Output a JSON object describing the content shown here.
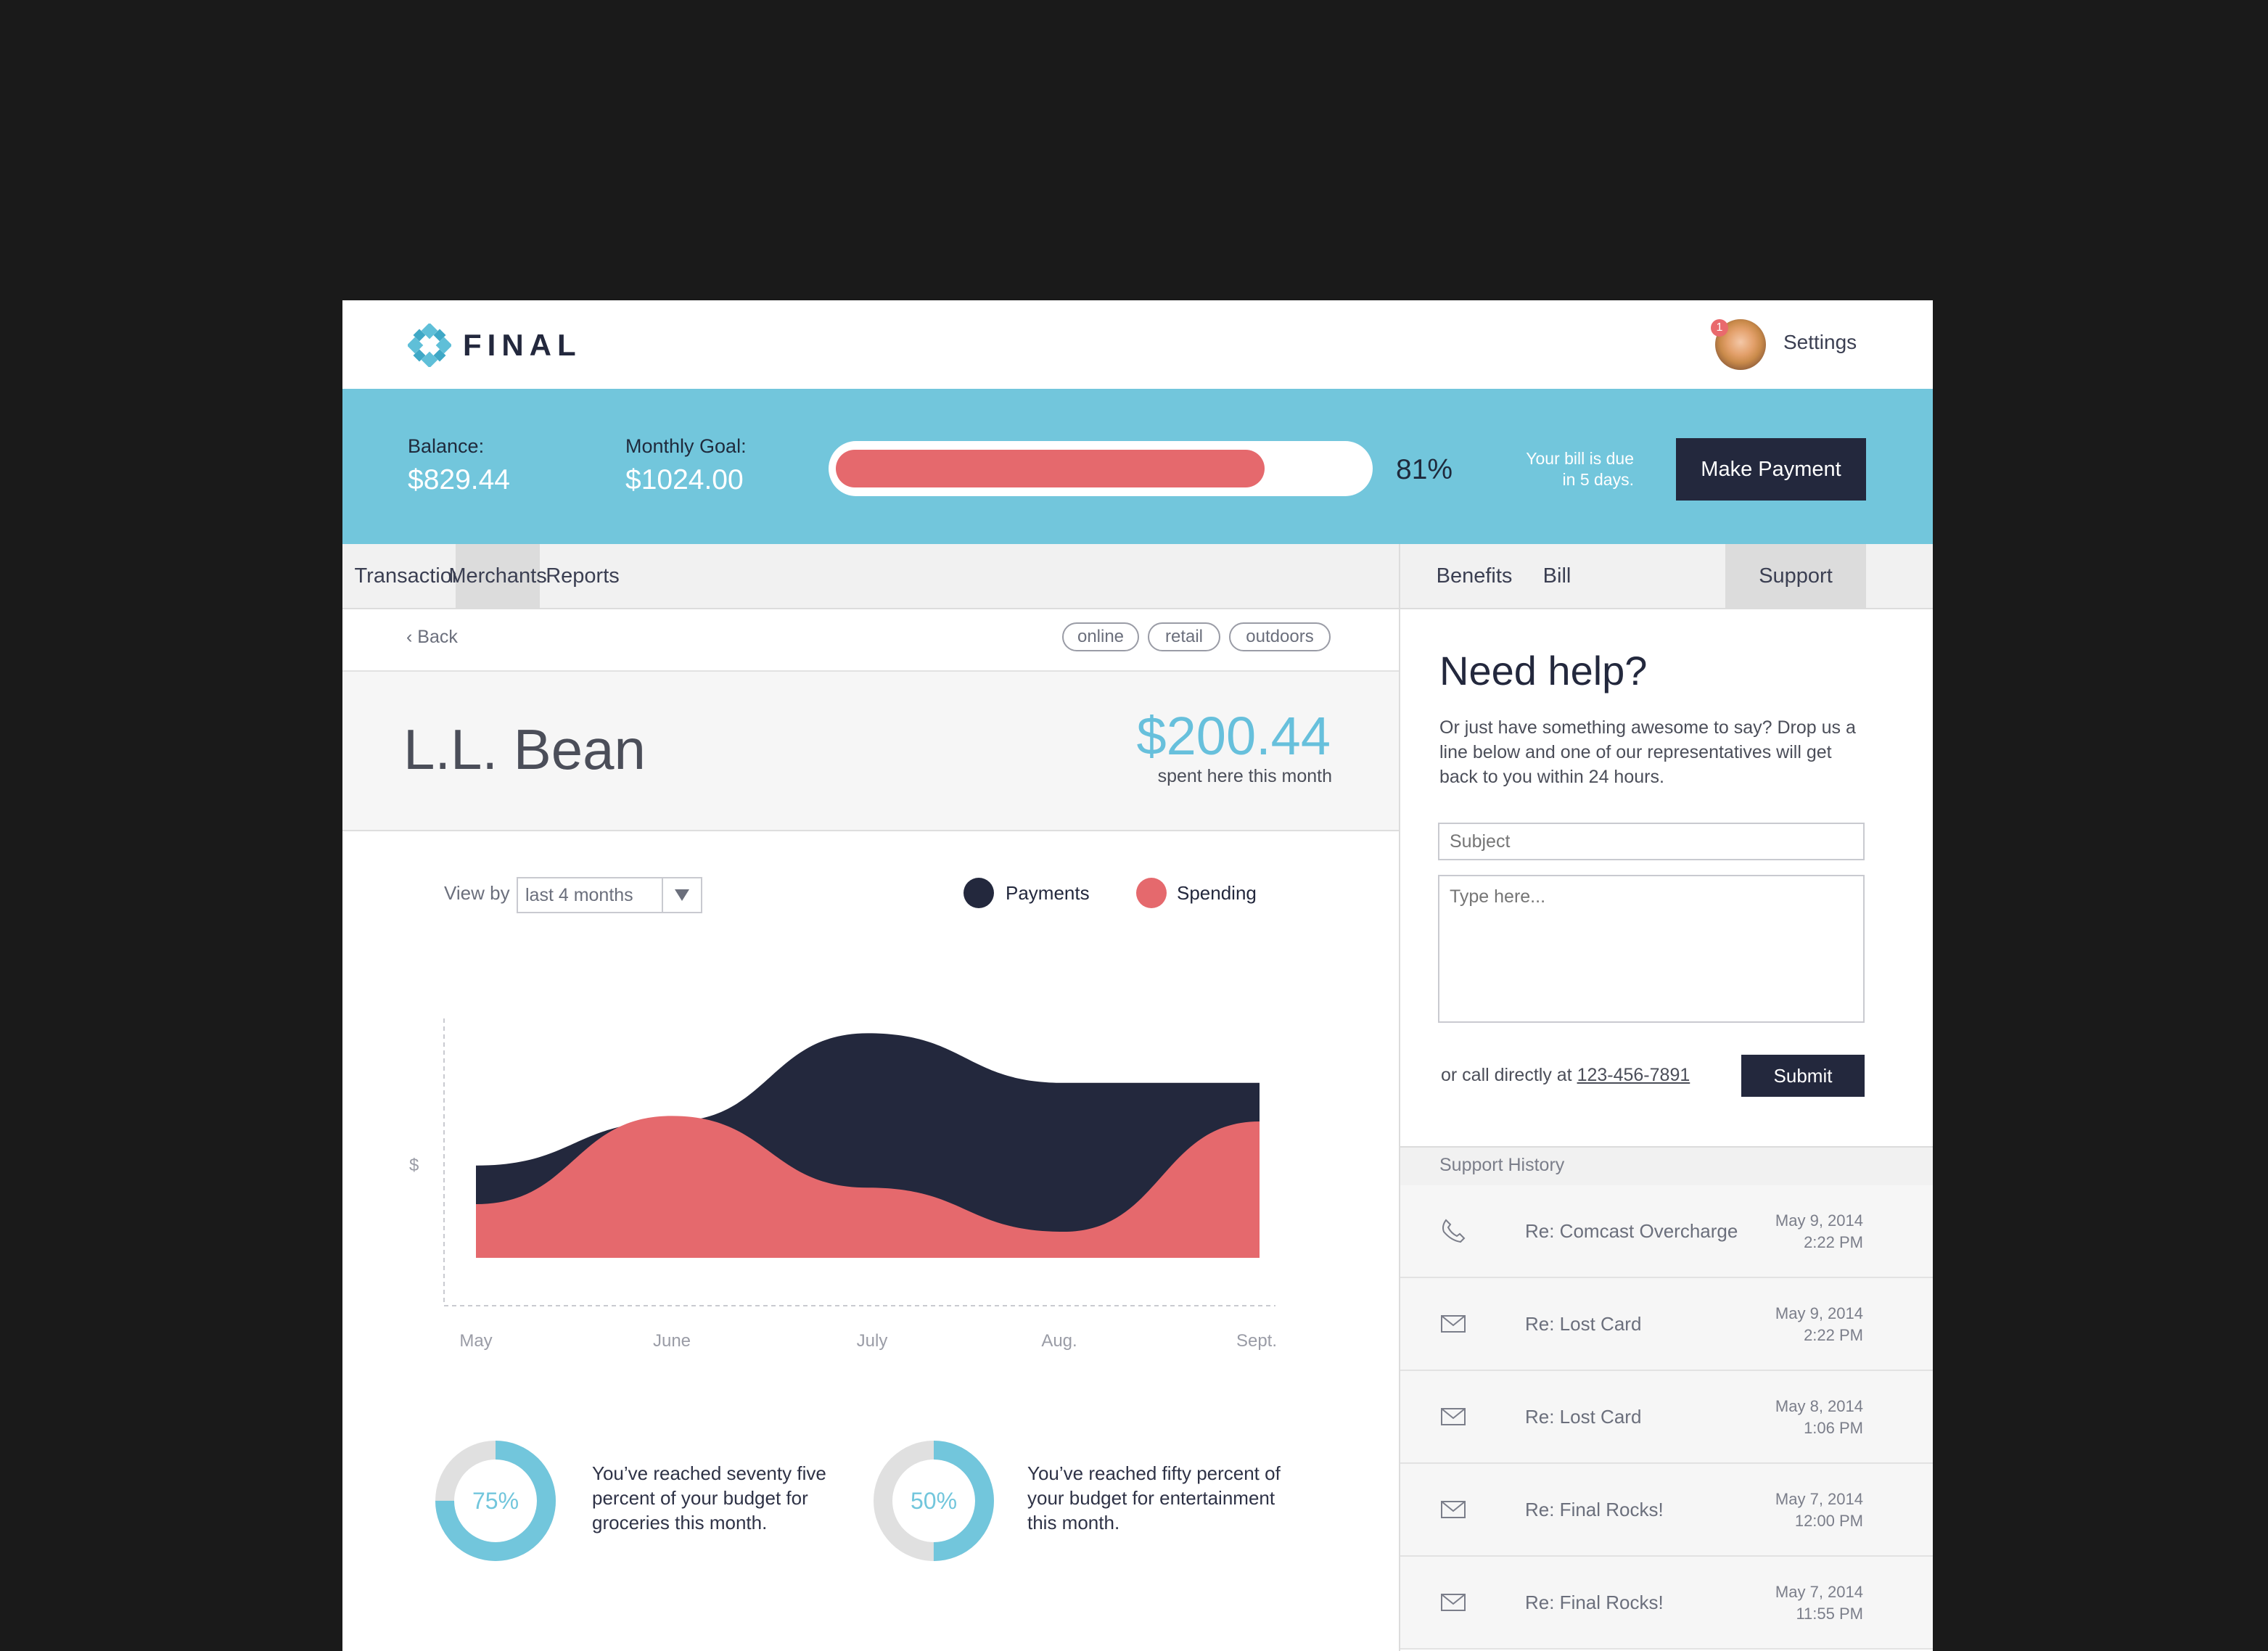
{
  "header": {
    "logo_text": "FINAL",
    "avatar_badge": "1",
    "settings_label": "Settings"
  },
  "banner": {
    "balance_label": "Balance:",
    "balance_value": "$829.44",
    "goal_label": "Monthly Goal:",
    "goal_value": "$1024.00",
    "progress_percent": 81,
    "progress_text": "81%",
    "bill_note_line1": "Your bill is due",
    "bill_note_line2": "in 5 days.",
    "pay_button": "Make Payment",
    "colors": {
      "banner": "#72c6dc",
      "progress_fill": "#e5696d",
      "button": "#23283d"
    }
  },
  "tabs_left": [
    "Transactions",
    "Merchants",
    "Reports"
  ],
  "tabs_left_active": "Merchants",
  "tabs_right": [
    "Benefits",
    "Bill",
    "Support"
  ],
  "tabs_right_active": "Support",
  "merchant": {
    "back_label": "Back",
    "tags": [
      "online",
      "retail",
      "outdoors"
    ],
    "name": "L.L. Bean",
    "amount": "$200.44",
    "amount_caption": "spent here this month"
  },
  "viewby": {
    "label": "View by",
    "value": "last 4 months"
  },
  "legend": [
    {
      "name": "Payments",
      "color": "#23283d"
    },
    {
      "name": "Spending",
      "color": "#e5696d"
    }
  ],
  "chart_data": {
    "type": "area",
    "ylabel": "$",
    "categories": [
      "May",
      "June",
      "July",
      "Aug.",
      "Sept."
    ],
    "series": [
      {
        "name": "Payments",
        "color": "#23283d",
        "values": [
          22,
          30,
          46,
          37,
          37
        ]
      },
      {
        "name": "Spending",
        "color": "#e5696d",
        "values": [
          15,
          31,
          18,
          10,
          30
        ]
      }
    ],
    "ylim": [
      0,
      50
    ],
    "grid": false
  },
  "budgets": [
    {
      "percent": 75,
      "label": "75%",
      "text_lines": [
        "You’ve reached seventy five",
        "percent of your budget for",
        "groceries this month."
      ]
    },
    {
      "percent": 50,
      "label": "50%",
      "text_lines": [
        "You’ve reached fifty percent of",
        "your budget for entertainment",
        "this month."
      ]
    }
  ],
  "support": {
    "title": "Need help?",
    "text": "Or just have something awesome to say? Drop us a line below and one of our representatives will get back to you within 24 hours.",
    "subject_placeholder": "Subject",
    "message_placeholder": "Type here...",
    "call_text": "or call directly at ",
    "phone": "123-456-7891",
    "submit": "Submit"
  },
  "history": {
    "header": "Support History",
    "items": [
      {
        "icon": "phone-icon",
        "subject": "Re: Comcast Overcharge",
        "date": "May 9, 2014",
        "time": "2:22 PM"
      },
      {
        "icon": "mail-icon",
        "subject": "Re: Lost Card",
        "date": "May 9, 2014",
        "time": "2:22 PM"
      },
      {
        "icon": "mail-icon",
        "subject": "Re: Lost Card",
        "date": "May 8, 2014",
        "time": "1:06 PM"
      },
      {
        "icon": "mail-icon",
        "subject": "Re: Final Rocks!",
        "date": "May 7, 2014",
        "time": "12:00 PM"
      },
      {
        "icon": "mail-icon",
        "subject": "Re: Final Rocks!",
        "date": "May 7, 2014",
        "time": "11:55 PM"
      }
    ]
  }
}
